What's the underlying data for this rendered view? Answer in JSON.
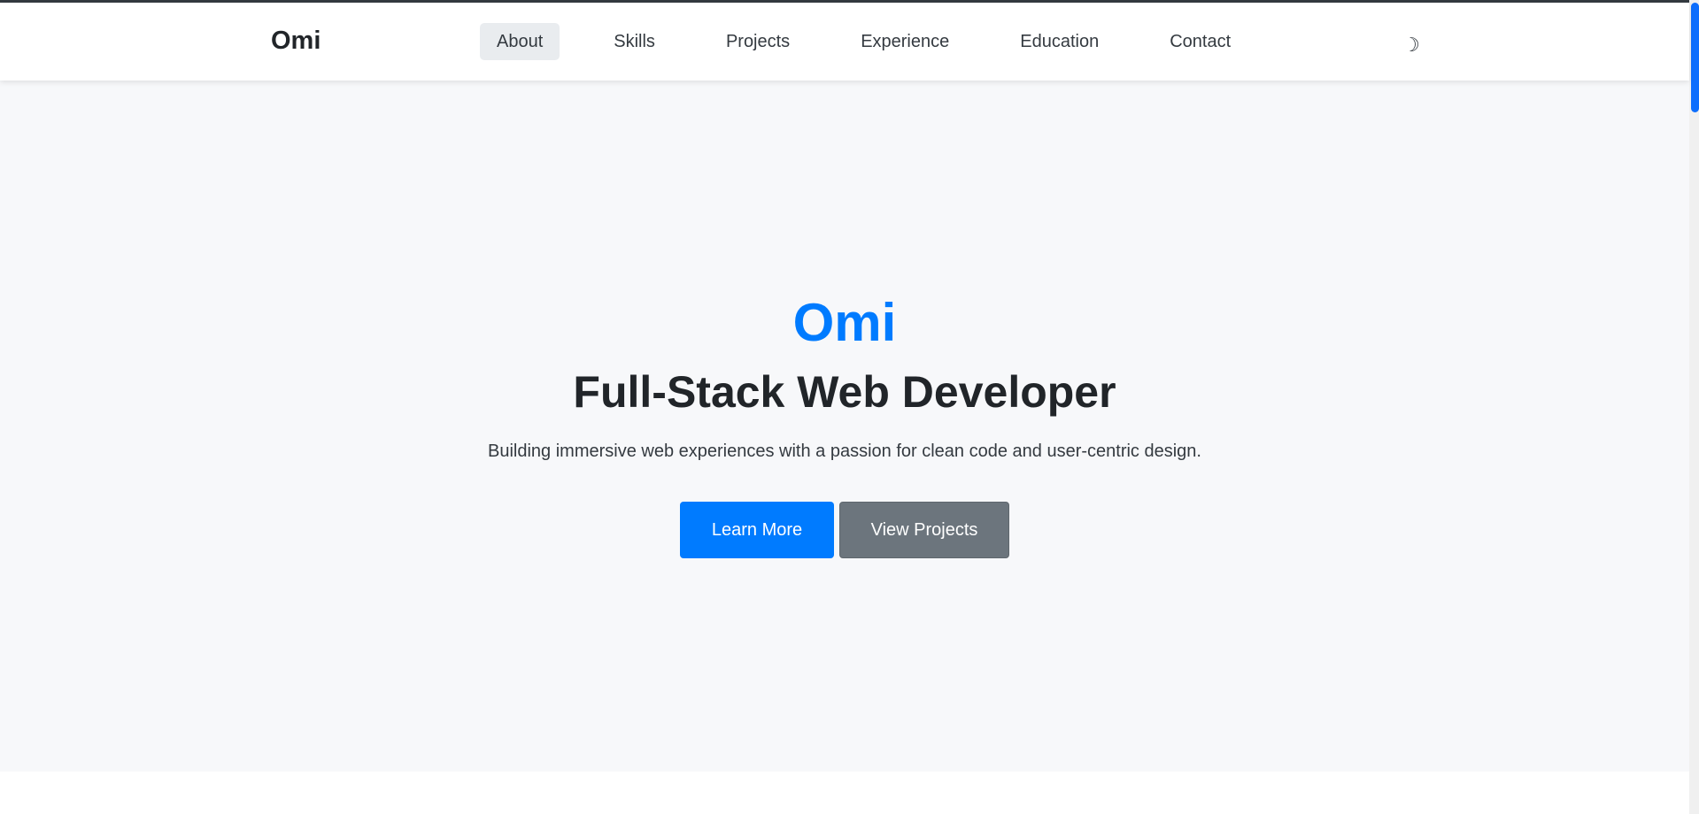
{
  "brand": "Omi",
  "nav": {
    "items": [
      {
        "label": "About",
        "active": true
      },
      {
        "label": "Skills",
        "active": false
      },
      {
        "label": "Projects",
        "active": false
      },
      {
        "label": "Experience",
        "active": false
      },
      {
        "label": "Education",
        "active": false
      },
      {
        "label": "Contact",
        "active": false
      }
    ],
    "theme_toggle_icon": "☽"
  },
  "hero": {
    "name": "Omi",
    "title": "Full-Stack Web Developer",
    "tagline": "Building immersive web experiences with a passion for clean code and user-centric design.",
    "primary_button": "Learn More",
    "secondary_button": "View Projects"
  },
  "icons": {
    "theme_toggle": "moon-icon"
  },
  "colors": {
    "accent": "#007bff",
    "secondary": "#6c757d",
    "hero_bg": "#f7f8fa",
    "text": "#212529",
    "scrollbar_thumb": "#0d6efd"
  }
}
